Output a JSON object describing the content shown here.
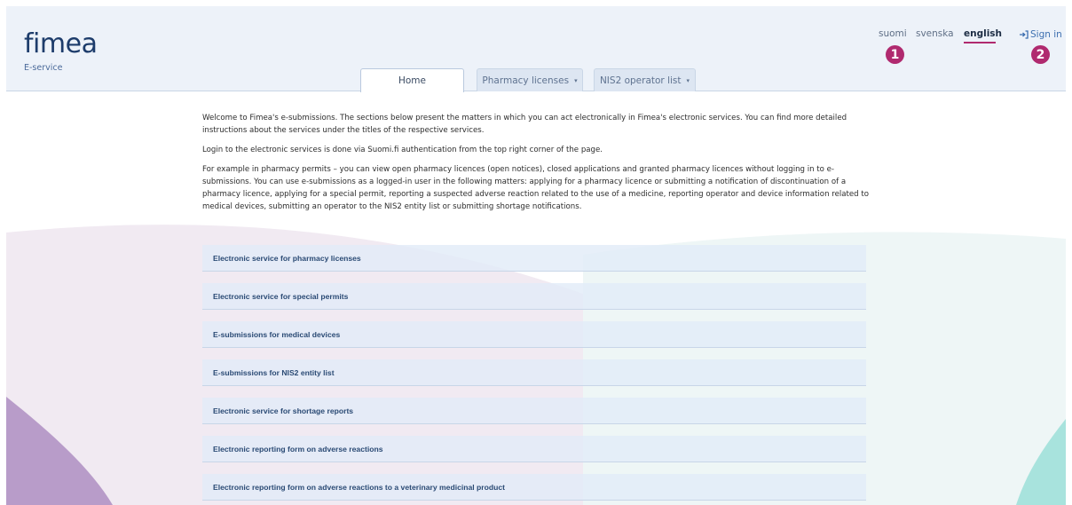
{
  "header": {
    "logo": "fimea",
    "subtitle": "E-service",
    "languages": [
      "suomi",
      "svenska",
      "english"
    ],
    "active_language": "english",
    "signin_icon": "sign-in-arrow-icon",
    "signin_label": "Sign in",
    "badges": [
      "1",
      "2"
    ]
  },
  "tabs": [
    {
      "label": "Home",
      "active": true
    },
    {
      "label": "Pharmacy licenses",
      "dropdown_icon": "caret-down-icon"
    },
    {
      "label": "NIS2 operator list",
      "dropdown_icon": "caret-down-icon"
    }
  ],
  "intro": [
    "Welcome to Fimea's e-submissions. The sections below present the matters in which you can act electronically in Fimea's electronic services. You can find more detailed instructions about the services under the titles of the respective services.",
    "Login to the electronic services is done via Suomi.fi authentication from the top right corner of the page.",
    "For example in pharmacy permits – you can view open pharmacy licences (open notices), closed applications and granted pharmacy licences without logging in to e-submissions. You can use e-submissions as a logged-in user in the following matters: applying for a pharmacy licence or submitting a notification of discontinuation of a pharmacy licence, applying for a special permit, reporting a suspected adverse reaction related to the use of a medicine, reporting operator and device information related to medical devices, submitting an operator to the NIS2 entity list or submitting shortage notifications."
  ],
  "services": [
    "Electronic service for pharmacy licenses",
    "Electronic service for special permits",
    "E-submissions for medical devices",
    "E-submissions for NIS2 entity list",
    "Electronic service for shortage reports",
    "Electronic reporting form on adverse reactions",
    "Electronic reporting form on adverse reactions to a veterinary medicinal product"
  ],
  "colors": {
    "brand": "#1d3c6b",
    "accent": "#b02a6f",
    "header_bg": "#edf2f9",
    "service_bg": "#e2ecf8"
  }
}
